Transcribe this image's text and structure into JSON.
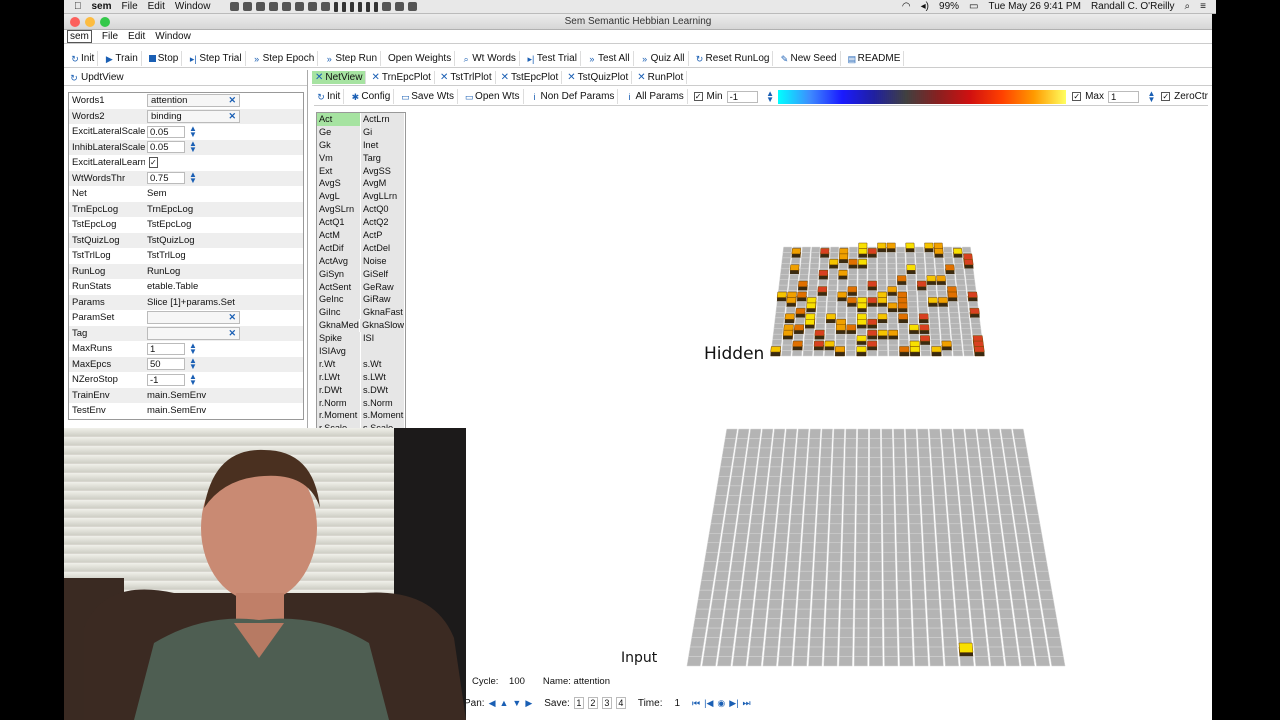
{
  "menubar": {
    "apple": "",
    "app": "sem",
    "items": [
      "File",
      "Edit",
      "Window"
    ],
    "datetime": "Tue May 26  9:41 PM",
    "user": "Randall C. O'Reilly",
    "battery": "99%"
  },
  "window": {
    "title": "Sem Semantic Hebbian Learning",
    "app_menu": [
      "sem",
      "File",
      "Edit",
      "Window"
    ]
  },
  "toolbar": {
    "buttons": [
      "Init",
      "Train",
      "Stop",
      "Step Trial",
      "Step Epoch",
      "Step Run",
      "Open Weights",
      "Wt Words",
      "Test Trial",
      "Test All",
      "Quiz All",
      "Reset RunLog",
      "New Seed",
      "README"
    ]
  },
  "left": {
    "updt": "UpdtView",
    "fields": [
      {
        "label": "Words1",
        "value": "attention",
        "kind": "text"
      },
      {
        "label": "Words2",
        "value": "binding",
        "kind": "text"
      },
      {
        "label": "ExcitLateralScale",
        "value": "0.05",
        "kind": "num"
      },
      {
        "label": "InhibLateralScale",
        "value": "0.05",
        "kind": "num"
      },
      {
        "label": "ExcitLateralLearn",
        "value": "✓",
        "kind": "check"
      },
      {
        "label": "WtWordsThr",
        "value": "0.75",
        "kind": "num"
      },
      {
        "label": "Net",
        "value": "Sem",
        "kind": "plain"
      },
      {
        "label": "TrnEpcLog",
        "value": "TrnEpcLog",
        "kind": "plain"
      },
      {
        "label": "TstEpcLog",
        "value": "TstEpcLog",
        "kind": "plain"
      },
      {
        "label": "TstQuizLog",
        "value": "TstQuizLog",
        "kind": "plain"
      },
      {
        "label": "TstTrlLog",
        "value": "TstTrlLog",
        "kind": "plain"
      },
      {
        "label": "RunLog",
        "value": "RunLog",
        "kind": "plain"
      },
      {
        "label": "RunStats",
        "value": "etable.Table",
        "kind": "plain"
      },
      {
        "label": "Params",
        "value": "Slice [1]+params.Set",
        "kind": "plain"
      },
      {
        "label": "ParamSet",
        "value": "",
        "kind": "text"
      },
      {
        "label": "Tag",
        "value": "",
        "kind": "text"
      },
      {
        "label": "MaxRuns",
        "value": "1",
        "kind": "num"
      },
      {
        "label": "MaxEpcs",
        "value": "50",
        "kind": "num"
      },
      {
        "label": "NZeroStop",
        "value": "-1",
        "kind": "num"
      },
      {
        "label": "TrainEnv",
        "value": "main.SemEnv",
        "kind": "plain"
      },
      {
        "label": "TestEnv",
        "value": "main.SemEnv",
        "kind": "plain"
      }
    ]
  },
  "tabs": [
    "NetView",
    "TrnEpcPlot",
    "TstTrlPlot",
    "TstEpcPlot",
    "TstQuizPlot",
    "RunPlot"
  ],
  "netview_toolbar": {
    "init": "Init",
    "config": "Config",
    "save_wts": "Save Wts",
    "open_wts": "Open Wts",
    "non_def": "Non Def Params",
    "all_params": "All Params",
    "min_label": "Min",
    "min_value": "-1",
    "max_label": "Max",
    "max_value": "1",
    "zeroctr": "ZeroCtr"
  },
  "vars": [
    [
      "Act",
      "ActLrn"
    ],
    [
      "Ge",
      "Gi"
    ],
    [
      "Gk",
      "Inet"
    ],
    [
      "Vm",
      "Targ"
    ],
    [
      "Ext",
      "AvgSS"
    ],
    [
      "AvgS",
      "AvgM"
    ],
    [
      "AvgL",
      "AvgLLrn"
    ],
    [
      "AvgSLrn",
      "ActQ0"
    ],
    [
      "ActQ1",
      "ActQ2"
    ],
    [
      "ActM",
      "ActP"
    ],
    [
      "ActDif",
      "ActDel"
    ],
    [
      "ActAvg",
      "Noise"
    ],
    [
      "GiSyn",
      "GiSelf"
    ],
    [
      "ActSent",
      "GeRaw"
    ],
    [
      "GeInc",
      "GiRaw"
    ],
    [
      "GiInc",
      "GknaFast"
    ],
    [
      "GknaMed",
      "GknaSlow"
    ],
    [
      "Spike",
      "ISI"
    ],
    [
      "ISIAvg",
      ""
    ],
    [
      "r.Wt",
      "s.Wt"
    ],
    [
      "r.LWt",
      "s.LWt"
    ],
    [
      "r.DWt",
      "s.DWt"
    ],
    [
      "r.Norm",
      "s.Norm"
    ],
    [
      "r.Moment",
      "s.Moment"
    ],
    [
      "r.Scale",
      "s.Scale"
    ]
  ],
  "layers": {
    "hidden": "Hidden",
    "input": "Input"
  },
  "status": {
    "cycle_label": "Cycle:",
    "cycle": "100",
    "name_label": "Name:",
    "name": "attention"
  },
  "bottom": {
    "pan": "Pan:",
    "save": "Save:",
    "slots": [
      "1",
      "2",
      "3",
      "4"
    ],
    "time_label": "Time:",
    "time": "1"
  },
  "colors": {
    "accent": "#1a5fb4",
    "active_tab": "#a6e3a1",
    "unit_gray": "#b4b4b4"
  }
}
